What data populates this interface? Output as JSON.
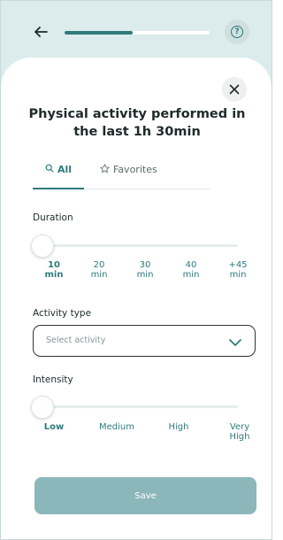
{
  "header": {
    "progress_fraction": 0.47,
    "help_icon_glyph": "?"
  },
  "modal": {
    "title": "Physical activity performed in the last 1h 30min",
    "tabs": [
      {
        "label": "All",
        "icon": "search-icon",
        "selected": true
      },
      {
        "label": "Favorites",
        "icon": "star-icon",
        "selected": false
      }
    ],
    "duration": {
      "label": "Duration",
      "selected_index": 0,
      "options": [
        {
          "value": "10",
          "unit": "min"
        },
        {
          "value": "20",
          "unit": "min"
        },
        {
          "value": "30",
          "unit": "min"
        },
        {
          "value": "40",
          "unit": "min"
        },
        {
          "value": "+45",
          "unit": "min"
        }
      ]
    },
    "activity_type": {
      "label": "Activity type",
      "placeholder": "Select activity"
    },
    "intensity": {
      "label": "Intensity",
      "selected_index": 0,
      "options": [
        {
          "line1": "Low",
          "line2": ""
        },
        {
          "line1": "Medium",
          "line2": ""
        },
        {
          "line1": "High",
          "line2": ""
        },
        {
          "line1": "Very",
          "line2": "High"
        }
      ]
    },
    "save_label": "Save"
  },
  "colors": {
    "accent": "#2f7a7c",
    "header_bg": "#dcebeb",
    "save_disabled": "#8bb7bb"
  }
}
